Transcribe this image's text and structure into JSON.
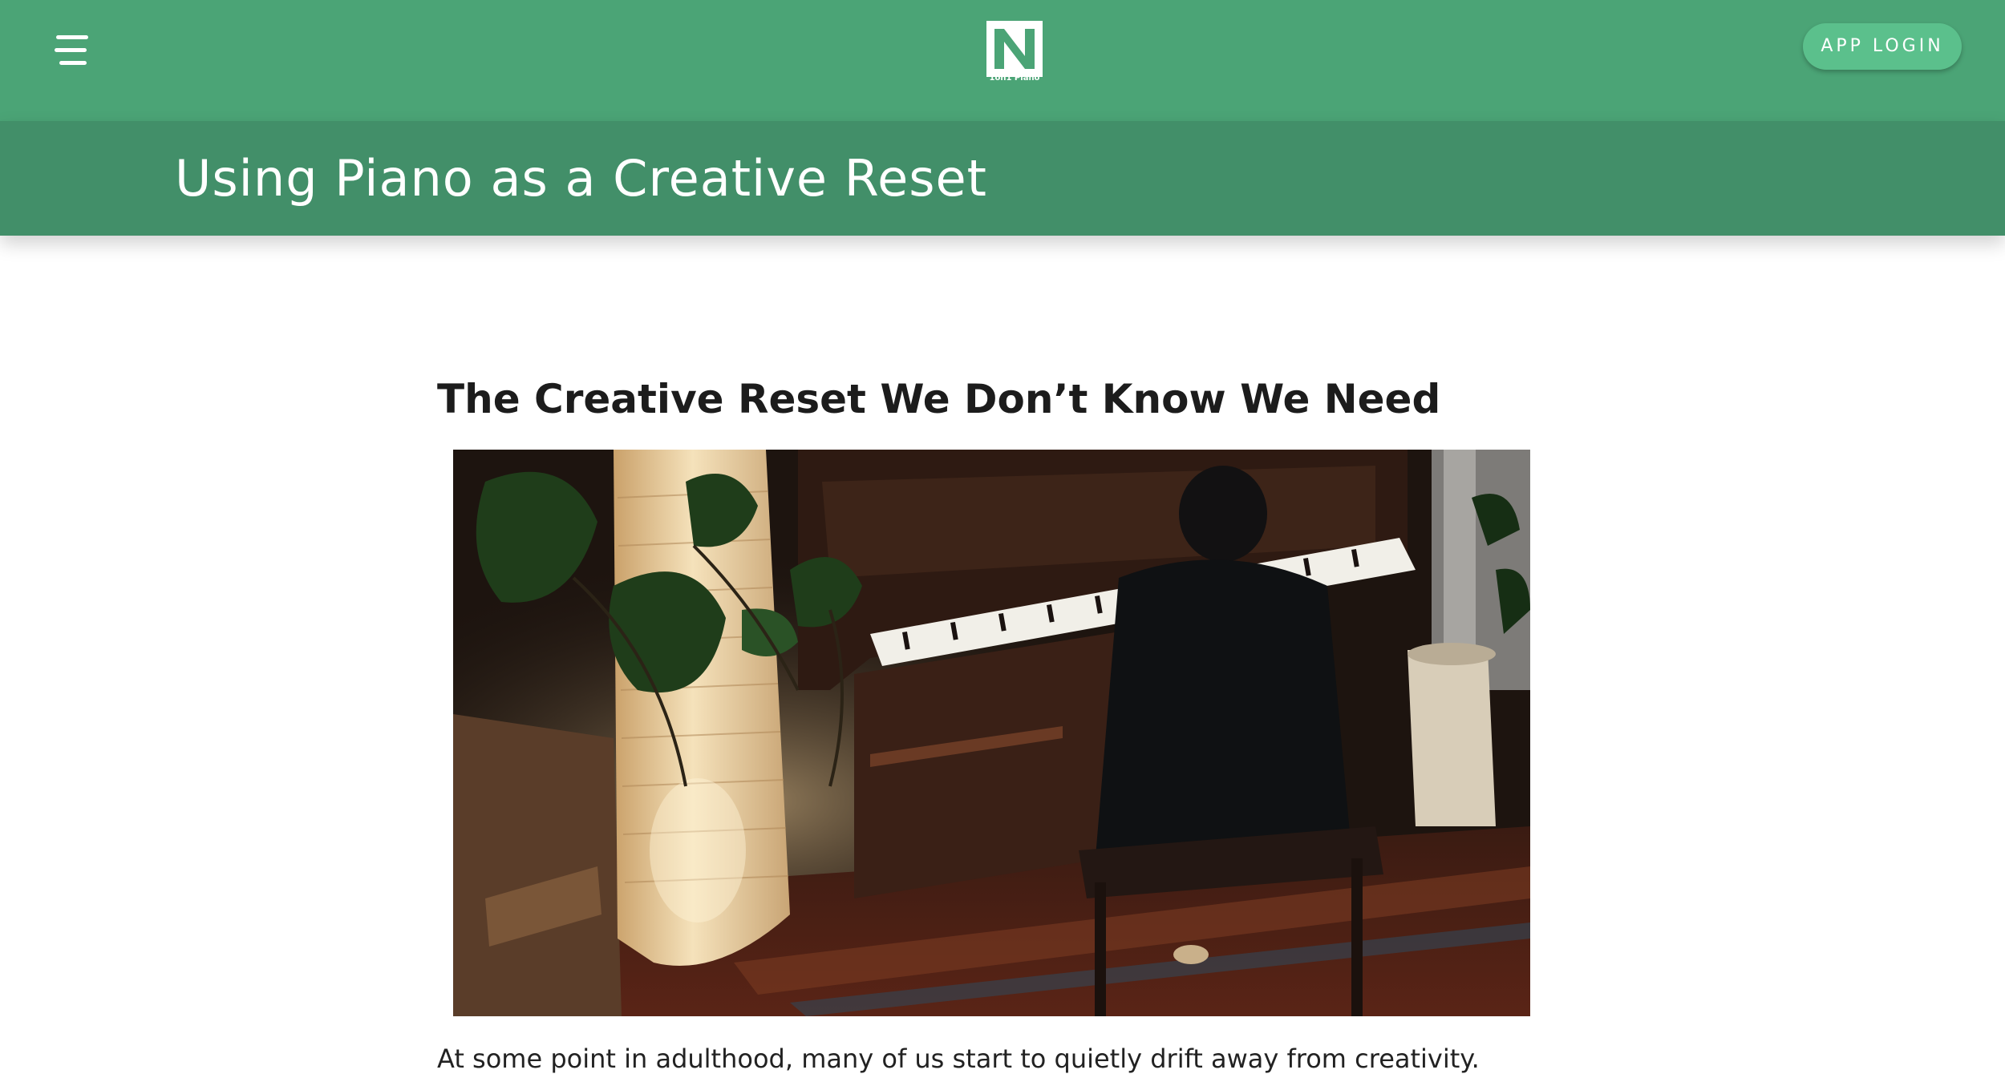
{
  "header": {
    "menu_icon": "hamburger-menu-icon",
    "logo": {
      "icon": "1on1-piano-logo-icon",
      "caption": "1on1 Piano"
    },
    "login_label": "APP LOGIN"
  },
  "title_band": {
    "title": "Using Piano as a Creative Reset"
  },
  "article": {
    "heading": "The Creative Reset We Don’t Know We Need",
    "image": "photo-person-playing-upright-piano",
    "paragraph": "At some point in adulthood, many of us start to quietly drift away from creativity."
  },
  "colors": {
    "header_bg": "#4ba476",
    "title_band_bg": "#428f69",
    "login_button_bg": "#5bc08c",
    "heading_text": "#1c1c1c",
    "body_text": "#222222"
  }
}
